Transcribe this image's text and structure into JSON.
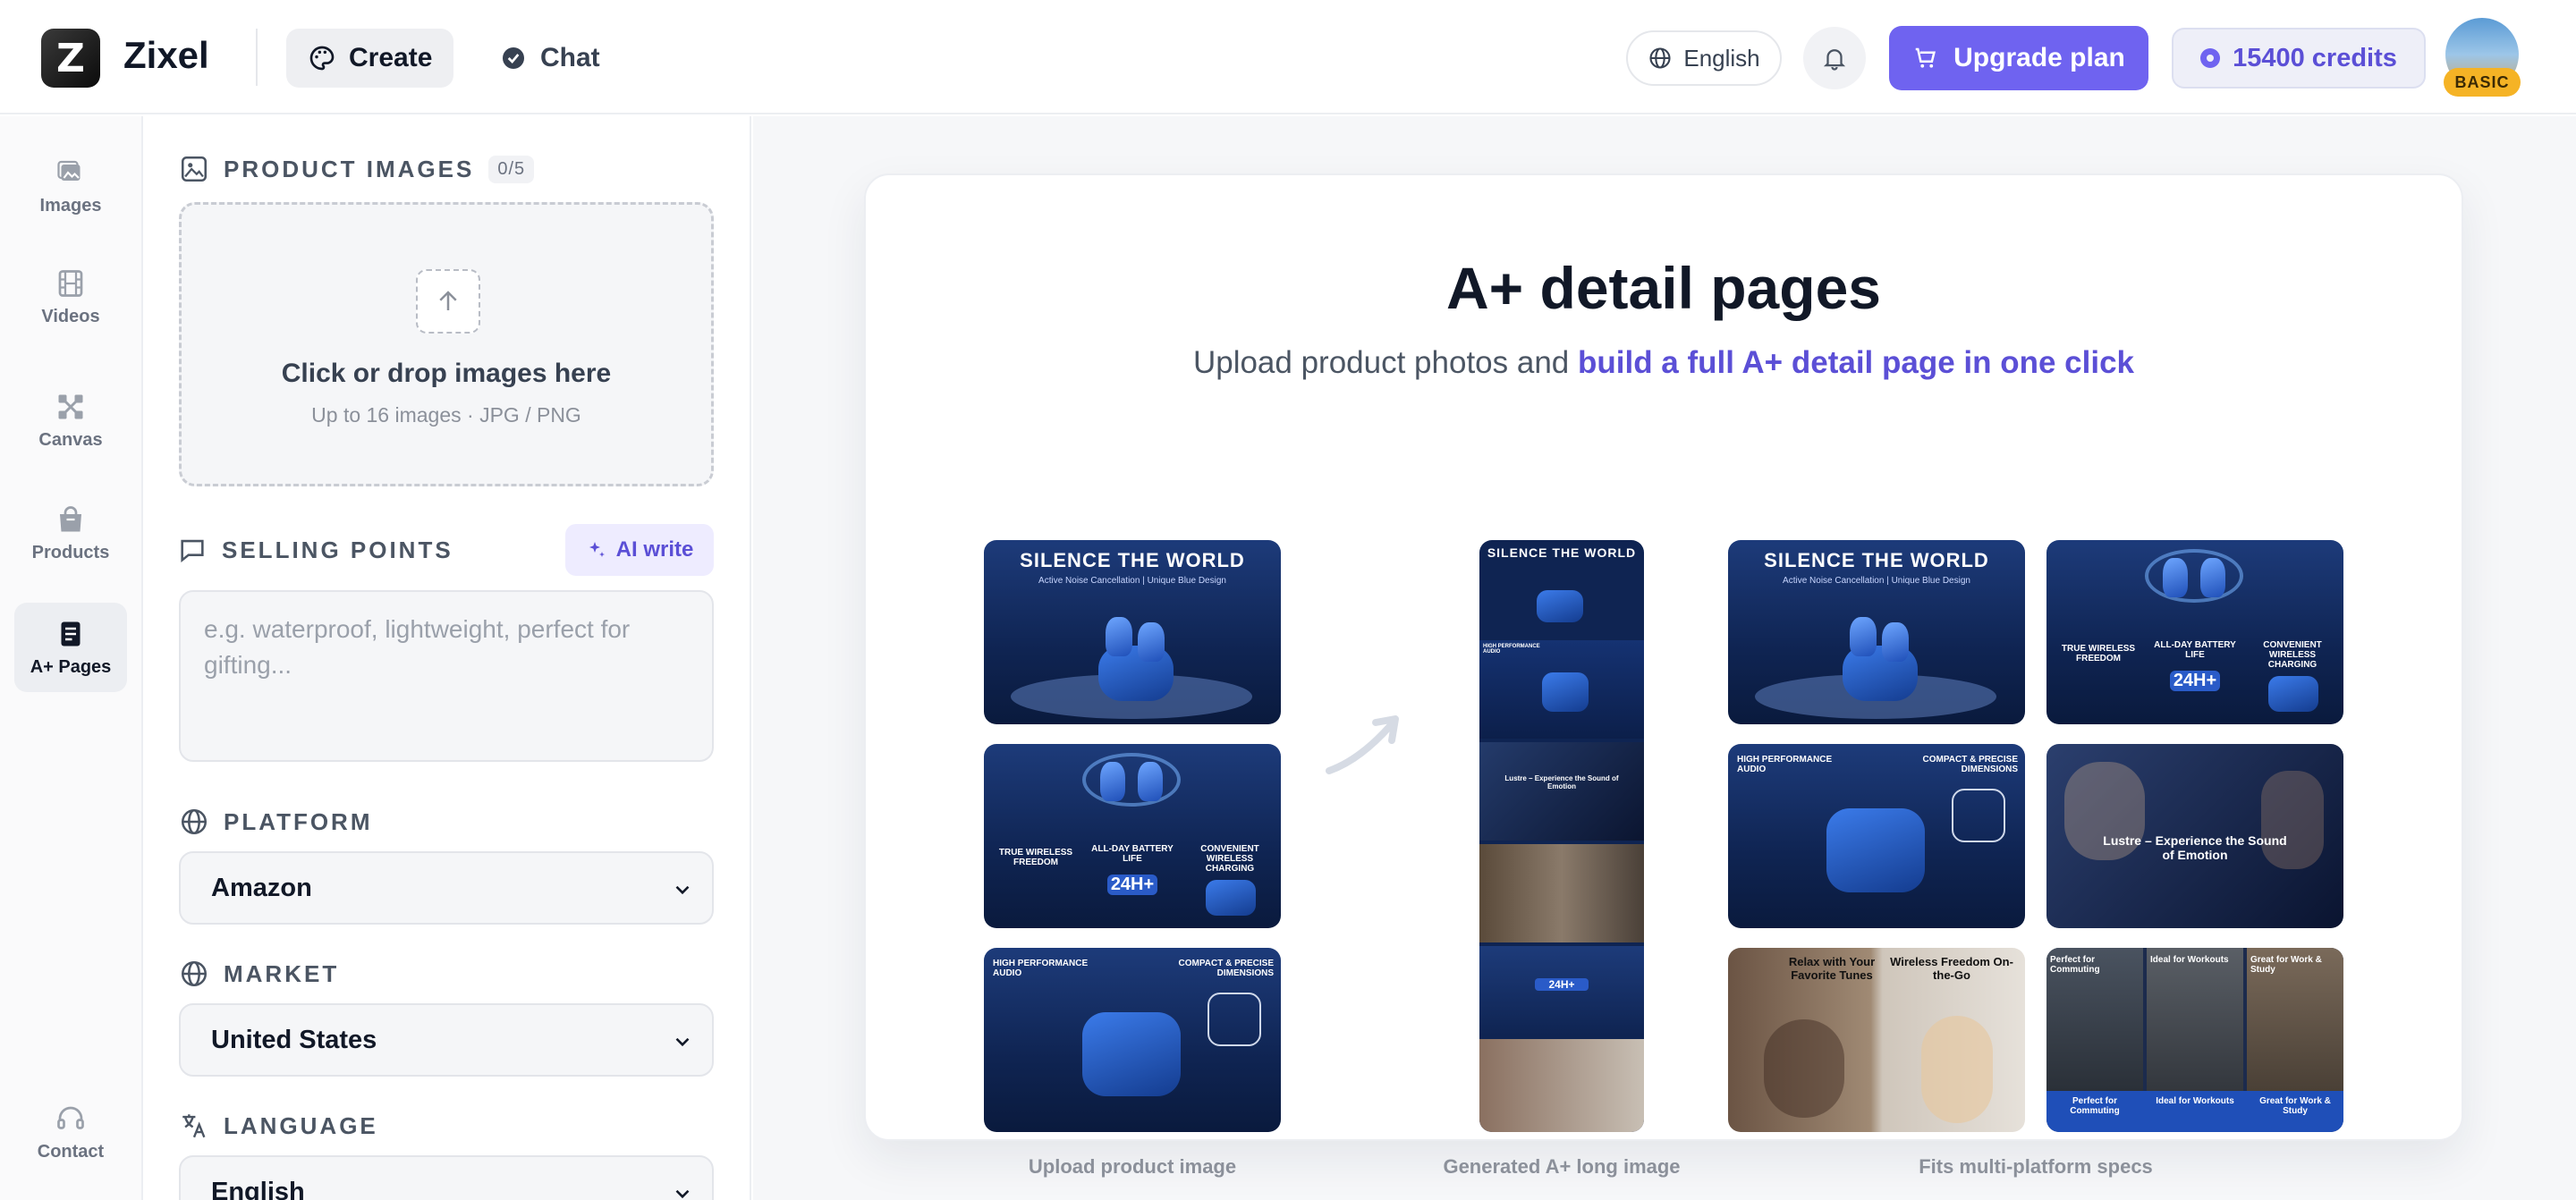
{
  "header": {
    "brand": "Zixel",
    "logo_letter": "Z",
    "tabs": [
      {
        "label": "Create",
        "icon": "palette-icon"
      },
      {
        "label": "Chat",
        "icon": "chat-bubble-icon"
      }
    ],
    "language": "English",
    "upgrade_label": "Upgrade plan",
    "credits": "15400 credits",
    "plan_badge": "BASIC"
  },
  "rail": {
    "items": [
      {
        "label": "Images",
        "icon": "images-icon"
      },
      {
        "label": "Videos",
        "icon": "film-icon"
      },
      {
        "label": "Canvas",
        "icon": "canvas-nodes-icon"
      },
      {
        "label": "Products",
        "icon": "shopping-bag-icon"
      },
      {
        "label": "A+ Pages",
        "icon": "document-icon"
      }
    ],
    "contact": "Contact"
  },
  "form": {
    "product_images": {
      "title": "PRODUCT IMAGES",
      "count": "0/5",
      "drop_main": "Click or drop images here",
      "drop_sub": "Up to 16 images · JPG / PNG"
    },
    "selling_points": {
      "title": "SELLING POINTS",
      "ai_write": "AI write",
      "placeholder": "e.g. waterproof, lightweight, perfect for gifting..."
    },
    "platform": {
      "title": "PLATFORM",
      "value": "Amazon"
    },
    "market": {
      "title": "MARKET",
      "value": "United States"
    },
    "language": {
      "title": "LANGUAGE",
      "value": "English"
    }
  },
  "preview": {
    "title": "A+ detail pages",
    "subtitle_plain": "Upload product photos and ",
    "subtitle_accent": "build a full A+ detail page in one click",
    "thumbs": {
      "silence": "SILENCE THE WORLD",
      "silence_sub": "Active Noise Cancellation | Unique Blue Design",
      "true_wireless": "TRUE WIRELESS FREEDOM",
      "battery": "ALL-DAY BATTERY LIFE",
      "charging": "CONVENIENT WIRELESS CHARGING",
      "battery_hours": "24H+",
      "high_perf": "HIGH PERFORMANCE AUDIO",
      "compact": "COMPACT & PRECISE DIMENSIONS",
      "lustre": "Lustre – Experience the Sound of Emotion",
      "relax": "Relax with Your Favorite Tunes",
      "wireless_go": "Wireless Freedom On-the-Go",
      "commuting": "Perfect for Commuting",
      "workouts": "Ideal for Workouts",
      "work_study": "Great for Work & Study"
    },
    "captions": [
      "Upload product image",
      "Generated A+ long image",
      "Fits multi-platform specs"
    ]
  }
}
